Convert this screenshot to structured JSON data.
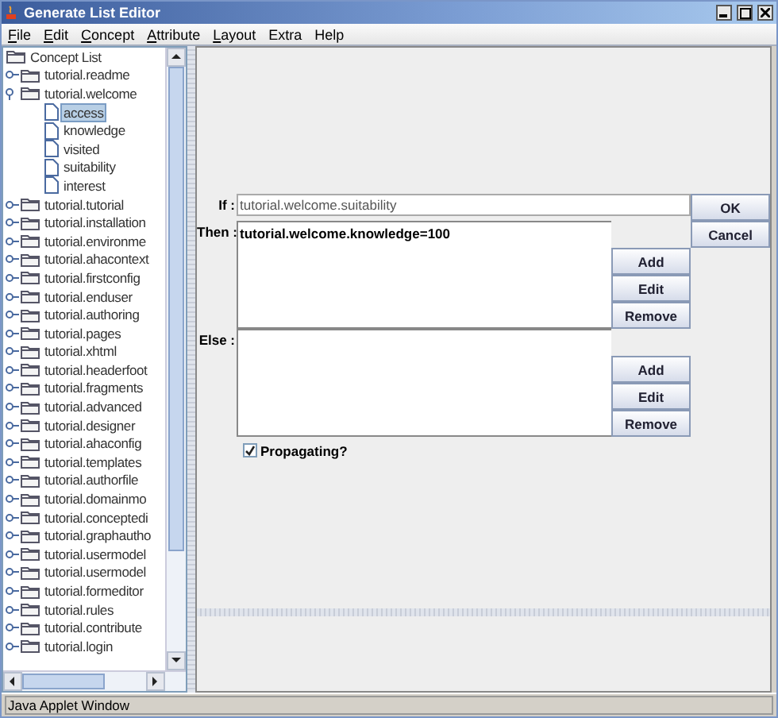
{
  "window": {
    "title": "Generate List Editor"
  },
  "menu": [
    {
      "label": "File",
      "mnemonic": true
    },
    {
      "label": "Edit",
      "mnemonic": true
    },
    {
      "label": "Concept",
      "mnemonic": true
    },
    {
      "label": "Attribute",
      "mnemonic": true
    },
    {
      "label": "Layout",
      "mnemonic": true
    },
    {
      "label": "Extra",
      "mnemonic": false
    },
    {
      "label": "Help",
      "mnemonic": false
    }
  ],
  "tree": {
    "root": "Concept List",
    "children": [
      {
        "label": "tutorial.readme",
        "expanded": false,
        "selected": false
      },
      {
        "label": "tutorial.welcome",
        "expanded": true,
        "selected": false,
        "children": [
          {
            "label": "access",
            "selected": true
          },
          {
            "label": "knowledge",
            "selected": false
          },
          {
            "label": "visited",
            "selected": false
          },
          {
            "label": "suitability",
            "selected": false
          },
          {
            "label": "interest",
            "selected": false
          }
        ]
      },
      {
        "label": "tutorial.tutorial",
        "expanded": false,
        "selected": false
      },
      {
        "label": "tutorial.installation",
        "expanded": false,
        "selected": false
      },
      {
        "label": "tutorial.environme",
        "expanded": false,
        "selected": false
      },
      {
        "label": "tutorial.ahacontext",
        "expanded": false,
        "selected": false
      },
      {
        "label": "tutorial.firstconfig",
        "expanded": false,
        "selected": false
      },
      {
        "label": "tutorial.enduser",
        "expanded": false,
        "selected": false
      },
      {
        "label": "tutorial.authoring",
        "expanded": false,
        "selected": false
      },
      {
        "label": "tutorial.pages",
        "expanded": false,
        "selected": false
      },
      {
        "label": "tutorial.xhtml",
        "expanded": false,
        "selected": false
      },
      {
        "label": "tutorial.headerfoot",
        "expanded": false,
        "selected": false
      },
      {
        "label": "tutorial.fragments",
        "expanded": false,
        "selected": false
      },
      {
        "label": "tutorial.advanced",
        "expanded": false,
        "selected": false
      },
      {
        "label": "tutorial.designer",
        "expanded": false,
        "selected": false
      },
      {
        "label": "tutorial.ahaconfig",
        "expanded": false,
        "selected": false
      },
      {
        "label": "tutorial.templates",
        "expanded": false,
        "selected": false
      },
      {
        "label": "tutorial.authorfile",
        "expanded": false,
        "selected": false
      },
      {
        "label": "tutorial.domainmo",
        "expanded": false,
        "selected": false
      },
      {
        "label": "tutorial.conceptedi",
        "expanded": false,
        "selected": false
      },
      {
        "label": "tutorial.graphautho",
        "expanded": false,
        "selected": false
      },
      {
        "label": "tutorial.usermodel",
        "expanded": false,
        "selected": false
      },
      {
        "label": "tutorial.usermodel",
        "expanded": false,
        "selected": false
      },
      {
        "label": "tutorial.formeditor",
        "expanded": false,
        "selected": false
      },
      {
        "label": "tutorial.rules",
        "expanded": false,
        "selected": false
      },
      {
        "label": "tutorial.contribute",
        "expanded": false,
        "selected": false
      },
      {
        "label": "tutorial.login",
        "expanded": false,
        "selected": false
      }
    ]
  },
  "form": {
    "if_label": "If :",
    "if_value": "tutorial.welcome.suitability",
    "then_label": "Then :",
    "then_items": [
      "tutorial.welcome.knowledge=100"
    ],
    "else_label": "Else :",
    "ok": "OK",
    "cancel": "Cancel",
    "then_buttons": [
      "Add",
      "Edit",
      "Remove"
    ],
    "else_buttons": [
      "Add",
      "Edit",
      "Remove"
    ],
    "propagating": {
      "label": "Propagating?",
      "checked": true
    }
  },
  "status_bar": "Java Applet Window"
}
